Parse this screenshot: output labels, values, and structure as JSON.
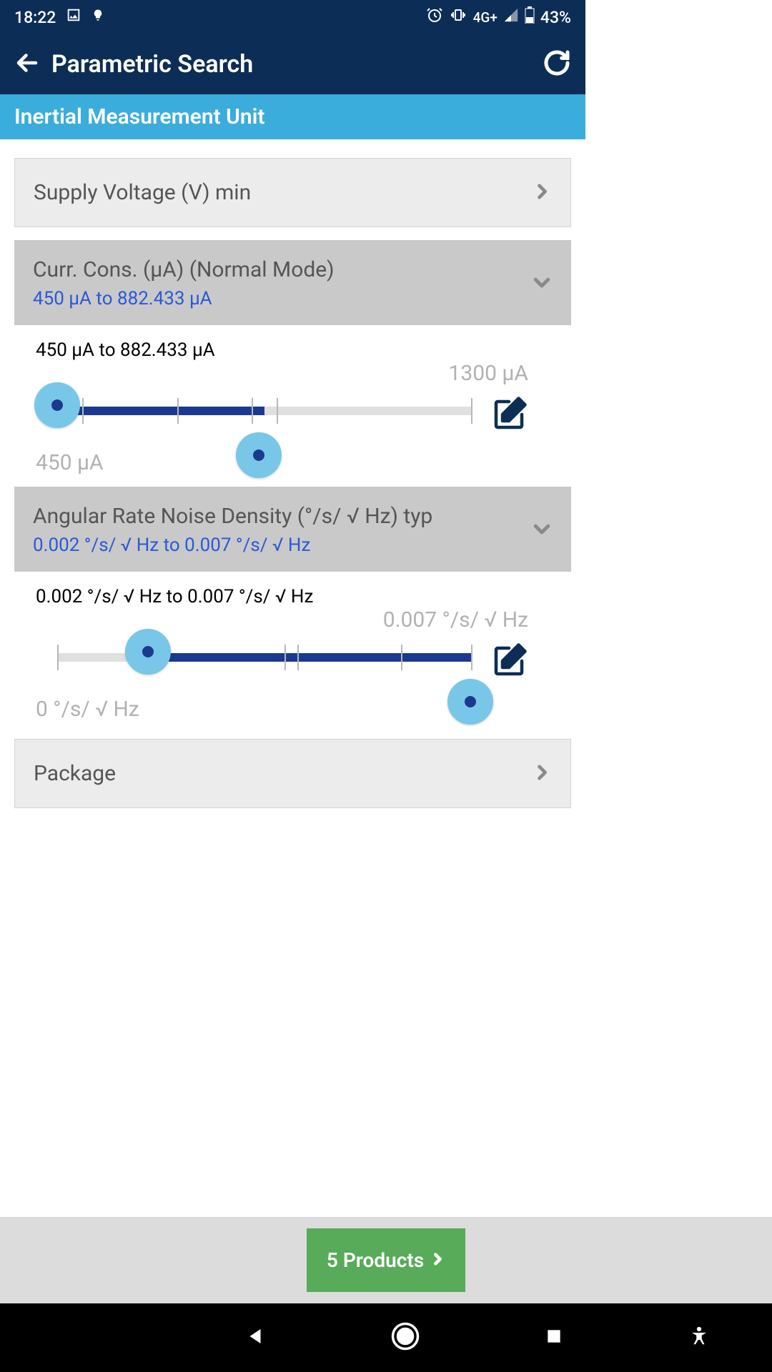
{
  "status": {
    "time": "18:22",
    "network": "4G+",
    "battery": "43%"
  },
  "appbar": {
    "title": "Parametric Search"
  },
  "subheader": "Inertial Measurement Unit",
  "filters": {
    "supply_voltage": {
      "label": "Supply Voltage (V) min"
    },
    "current_consumption": {
      "label": "Curr. Cons. (µA) (Normal Mode)",
      "summary": "450 µA to 882.433 µA",
      "range_text": "450 µA to 882.433 µA",
      "min_label": "450 µA",
      "max_label": "1300 µA"
    },
    "angular_rate_noise": {
      "label": "Angular Rate Noise Density (°/s/ √ Hz) typ",
      "summary": "0.002 °/s/ √ Hz to 0.007 °/s/ √ Hz",
      "range_text": "0.002 °/s/ √ Hz to 0.007 °/s/ √ Hz",
      "min_label": "0 °/s/ √ Hz",
      "max_label": "0.007 °/s/ √ Hz"
    },
    "package": {
      "label": "Package"
    }
  },
  "results": {
    "label": "5 Products"
  }
}
